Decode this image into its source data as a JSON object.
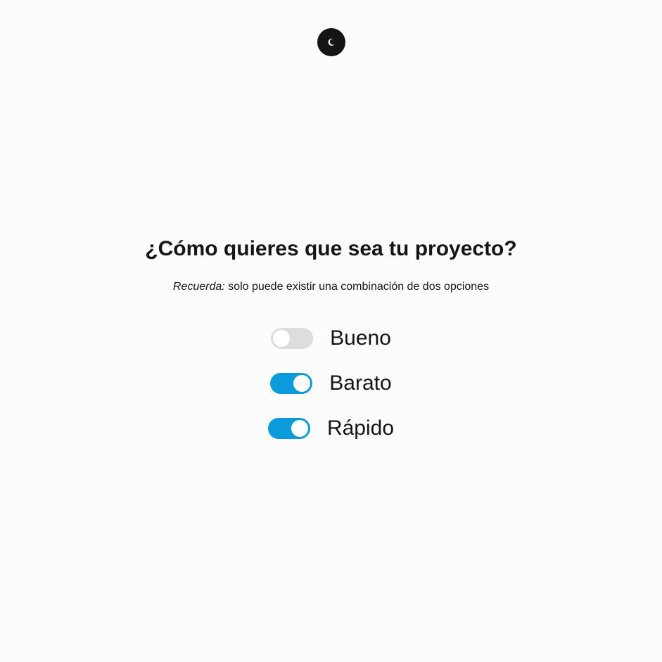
{
  "theme_toggle": {
    "icon": "moon-icon"
  },
  "header": {
    "title": "¿Cómo quieres que sea tu proyecto?",
    "subtitle_emphasis": "Recuerda:",
    "subtitle_text": " solo puede existir una combinación de dos opciones"
  },
  "options": [
    {
      "label": "Bueno",
      "checked": false
    },
    {
      "label": "Barato",
      "checked": true
    },
    {
      "label": "Rápido",
      "checked": true
    }
  ],
  "colors": {
    "background": "#fcfcfc",
    "switch_on": "#0b9ada",
    "switch_off": "#dddddd",
    "toggle_bg": "#151515"
  }
}
